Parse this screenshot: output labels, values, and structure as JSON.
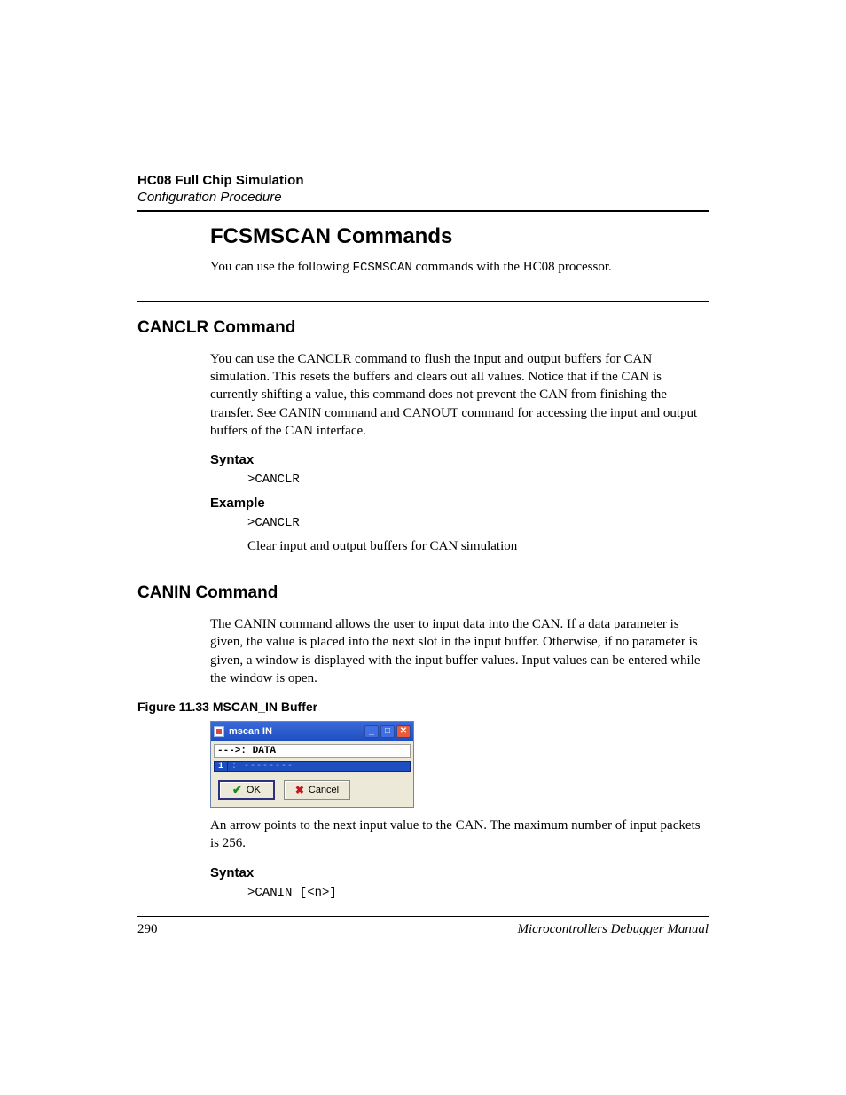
{
  "header": {
    "title_bold": "HC08 Full Chip Simulation",
    "title_italic": "Configuration Procedure"
  },
  "h1": "FCSMSCAN Commands",
  "intro_pre": "You can use the following ",
  "intro_code": "FCSMSCAN",
  "intro_post": " commands with the HC08 processor.",
  "canclr": {
    "heading": "CANCLR Command",
    "body": "You can use the CANCLR command to flush the input and output buffers for CAN simulation. This resets the buffers and clears out all values. Notice that if the CAN is currently shifting a value, this command does not prevent the CAN from finishing the transfer. See CANIN command and CANOUT command for accessing the input and output buffers of the CAN interface.",
    "syntax_label": "Syntax",
    "syntax_code": ">CANCLR",
    "example_label": "Example",
    "example_code": ">CANCLR",
    "example_text": "Clear input and output buffers for CAN simulation"
  },
  "canin": {
    "heading": "CANIN Command",
    "body": "The CANIN command allows the user to input data into the CAN. If a data parameter is given, the value is placed into the next slot in the input buffer. Otherwise, if no parameter is given, a window is displayed with the input buffer values. Input values can be entered while the window is open.",
    "figure_caption": "Figure 11.33  MSCAN_IN Buffer",
    "dialog": {
      "title": "mscan IN",
      "data_label": "--->: DATA",
      "index": "1",
      "index_dots": ": --------",
      "ok": "OK",
      "cancel": "Cancel"
    },
    "after_figure": "An arrow points to the next input value to the CAN. The maximum number of input packets is 256.",
    "syntax_label": "Syntax",
    "syntax_code": ">CANIN [<n>]"
  },
  "footer": {
    "page": "290",
    "manual": "Microcontrollers Debugger Manual"
  }
}
